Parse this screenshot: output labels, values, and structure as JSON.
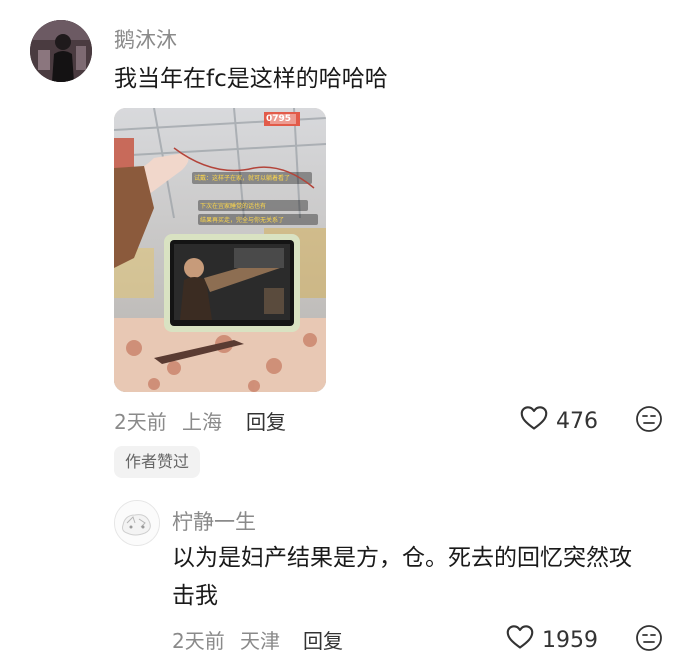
{
  "comment1": {
    "username": "鹅沐沐",
    "text": "我当年在fc是这样的哈哈哈",
    "image": {
      "price_tag": "0795",
      "caption_line1": "试戴：这样子在家，就可以躺着看了",
      "caption_line2": "下次在宜家睡觉的话也有",
      "caption_line3": "结果再买走，完全与你无关系了"
    },
    "time": "2天前",
    "location": "上海",
    "reply_label": "回复",
    "like_count": "476",
    "badge": "作者赞过"
  },
  "comment2": {
    "username": "柠静一生",
    "text_line1": "以为是妇产结果是方，仓。死去的回忆突然攻",
    "text_line2": "击我",
    "time": "2天前",
    "location": "天津",
    "reply_label": "回复",
    "like_count": "1959"
  },
  "icons": {
    "like": "heart-outline-icon",
    "dislike": "meh-face-icon"
  }
}
